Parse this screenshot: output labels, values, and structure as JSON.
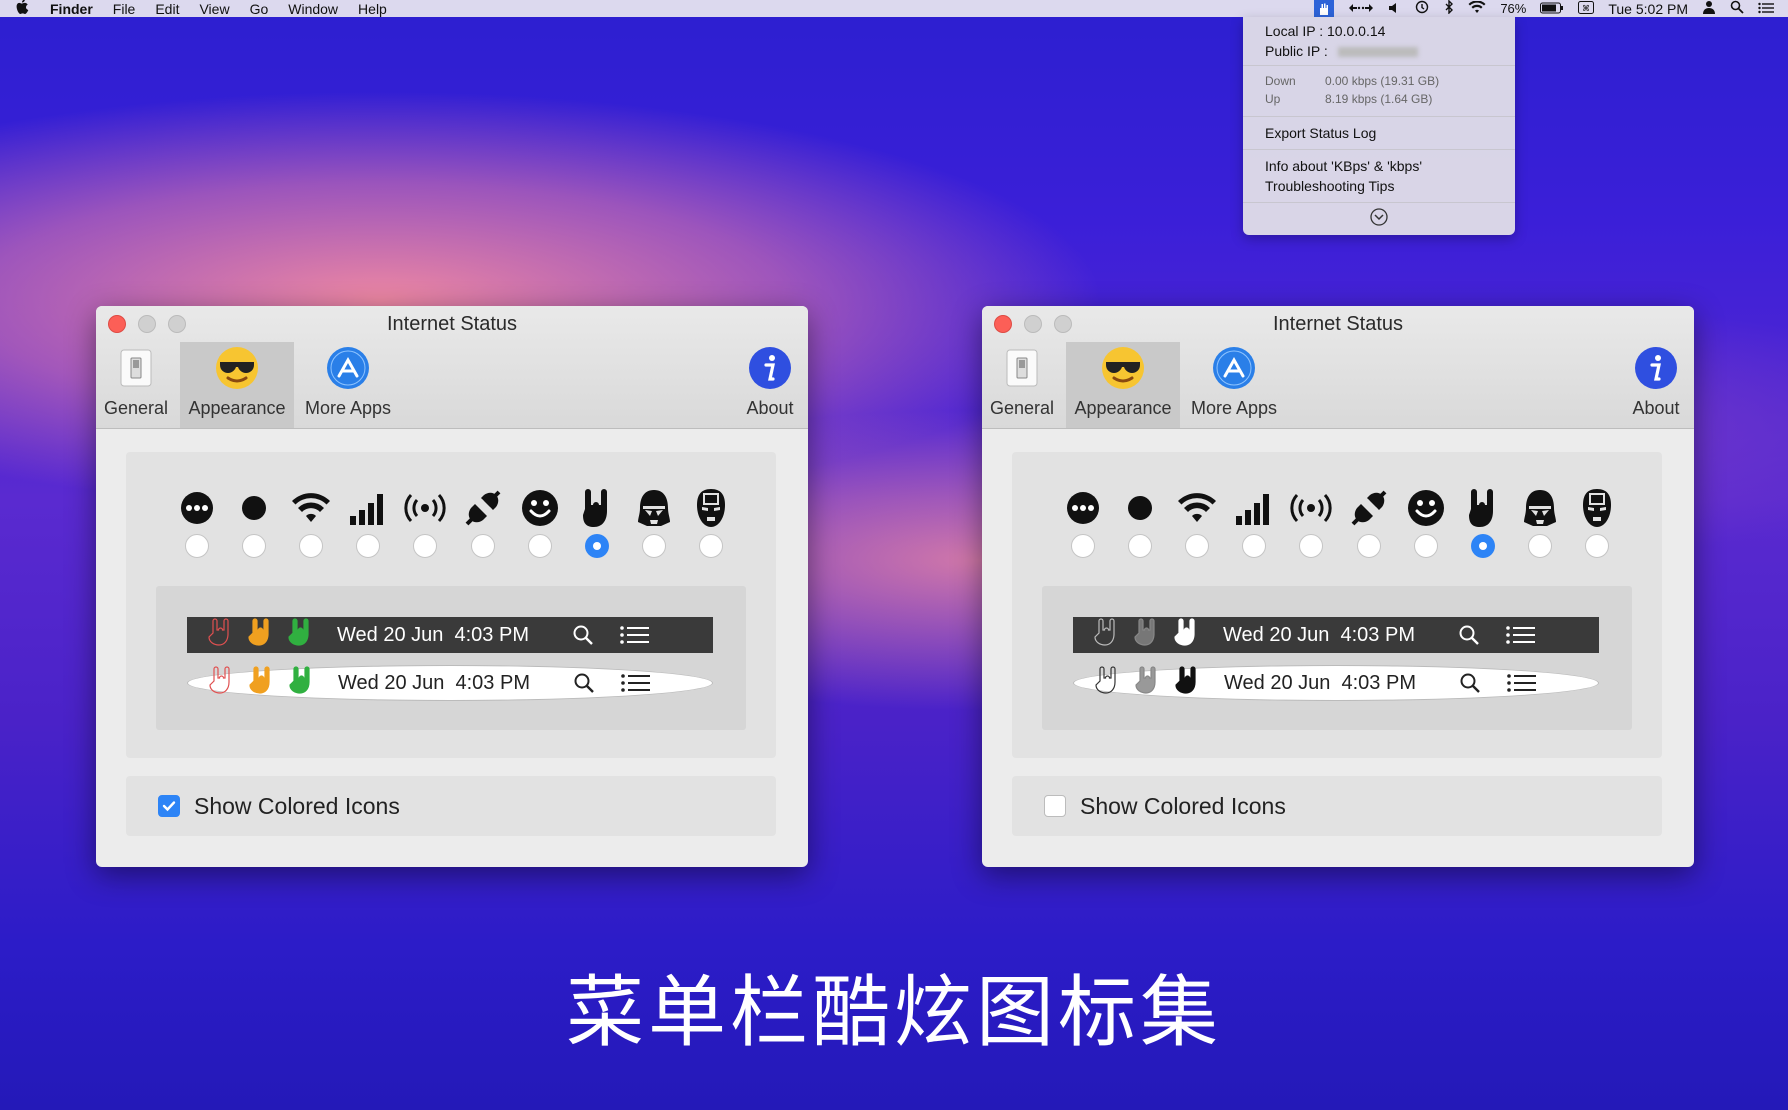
{
  "menubar": {
    "app": "Finder",
    "menus": [
      "File",
      "Edit",
      "View",
      "Go",
      "Window",
      "Help"
    ],
    "battery": "76%",
    "clock": "Tue 5:02 PM"
  },
  "dropdown": {
    "local_ip_label": "Local IP",
    "local_ip_value": ": 10.0.0.14",
    "public_ip_label": "Public IP",
    "public_ip_value": ":",
    "down_label": "Down",
    "down_value": "0.00 kbps (19.31 GB)",
    "up_label": "Up",
    "up_value": "8.19 kbps (1.64 GB)",
    "export": "Export Status Log",
    "info": "Info about 'KBps' & 'kbps'",
    "tips": "Troubleshooting Tips"
  },
  "windows": [
    {
      "title": "Internet Status",
      "tabs": {
        "general": "General",
        "appearance": "Appearance",
        "more_apps": "More Apps",
        "about": "About"
      },
      "preview_date": "Wed 20 Jun",
      "preview_time": "4:03 PM",
      "colored_label": "Show Colored Icons",
      "colored_checked": true,
      "hand_colors": [
        "#e05050",
        "#f0a020",
        "#30b040"
      ]
    },
    {
      "title": "Internet Status",
      "tabs": {
        "general": "General",
        "appearance": "Appearance",
        "more_apps": "More Apps",
        "about": "About"
      },
      "preview_date": "Wed 20 Jun",
      "preview_time": "4:03 PM",
      "colored_label": "Show Colored Icons",
      "colored_checked": false,
      "hand_colors": [
        "#8a8a8a",
        "#b0b0b0",
        "#ffffff"
      ]
    }
  ],
  "icon_styles": [
    "dots-icon",
    "dot-icon",
    "wifi-icon",
    "signal-bars-icon",
    "broadcast-icon",
    "plug-icon",
    "smiley-icon",
    "rock-hand-icon",
    "stormtrooper-icon",
    "ironman-icon"
  ],
  "selected_style": 7,
  "caption": "菜单栏酷炫图标集",
  "colors": {
    "accent": "#2d84f6",
    "close": "#fc5f57"
  }
}
